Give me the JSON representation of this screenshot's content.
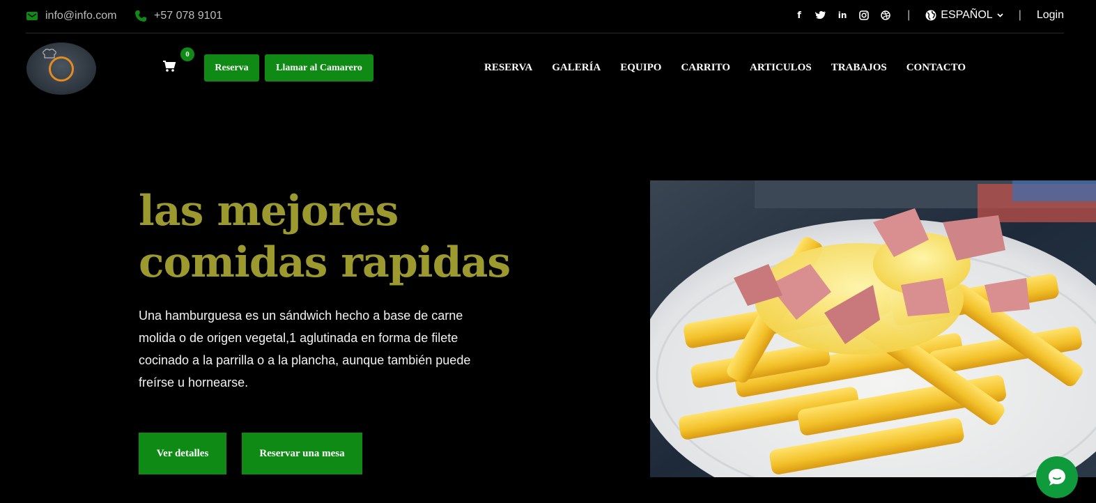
{
  "topbar": {
    "email": "info@info.com",
    "phone": "+57 078 9101",
    "socials": [
      "facebook-icon",
      "twitter-icon",
      "linkedin-icon",
      "instagram-icon",
      "dribbble-icon"
    ],
    "separator": "|",
    "language": "ESPAÑOL",
    "login": "Login"
  },
  "nav": {
    "cart_count": "0",
    "reserve_button": "Reserva",
    "call_waiter_button": "Llamar al Camarero",
    "menu": [
      "RESERVA",
      "GALERÍA",
      "EQUIPO",
      "CARRITO",
      "ARTICULOS",
      "TRABAJOS",
      "CONTACTO"
    ]
  },
  "hero": {
    "title_line1": "las mejores",
    "title_line2": "comidas rapidas",
    "description": "Una hamburguesa es un sándwich hecho a base de carne molida o de origen vegetal,1 aglutinada en forma de filete cocinado a la parrilla o a la plancha, aunque también puede freírse u hornearse.",
    "details_button": "Ver detalles",
    "reserve_table_button": "Reservar una mesa"
  },
  "colors": {
    "accent_green": "#0f8a14",
    "title_olive": "#9c9a2e",
    "background": "#000000"
  }
}
